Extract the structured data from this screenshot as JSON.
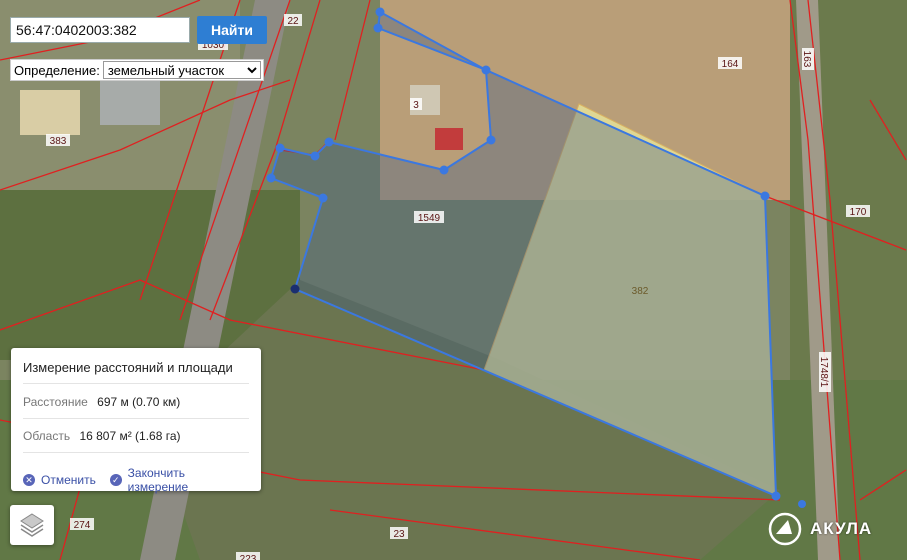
{
  "search": {
    "value": "56:47:0402003:382",
    "button_label": "Найти"
  },
  "definition": {
    "label": "Определение:",
    "selected": "земельный участок"
  },
  "map_labels": {
    "p22": "22",
    "p1030": "1030",
    "p383": "383",
    "p3": "3",
    "p164": "164",
    "p163": "163",
    "p1549": "1549",
    "p170": "170",
    "p382": "382",
    "p17481": "1748/1",
    "p274": "274",
    "p23": "23",
    "p223": "223"
  },
  "measure": {
    "title": "Измерение расстояний и площади",
    "distance_label": "Расстояние",
    "distance_value": "697 м (0.70 км)",
    "area_label": "Область",
    "area_value": "16 807 м² (1.68 га)",
    "cancel_label": "Отменить",
    "finish_label": "Закончить измерение"
  },
  "logo": {
    "text": "АКУЛА"
  },
  "colors": {
    "boundary": "#e02020",
    "measure": "#3b78e0",
    "parcel_fill": "#e8e39a",
    "button": "#2e7ed3"
  }
}
